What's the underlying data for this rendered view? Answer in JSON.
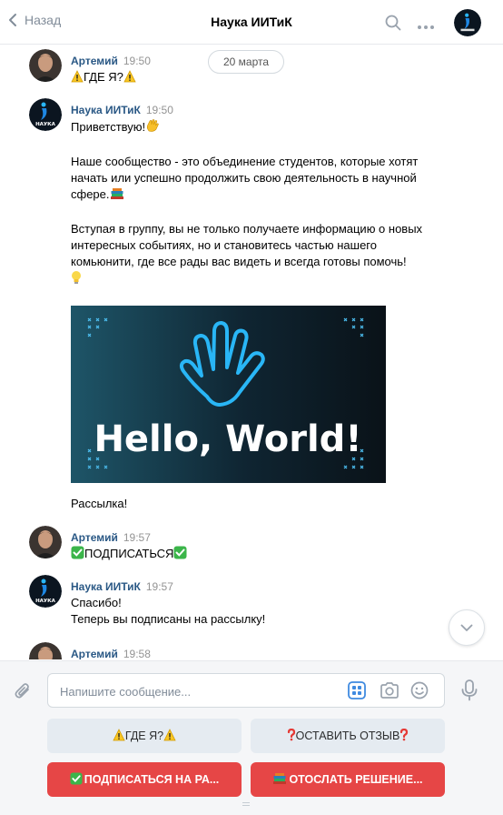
{
  "header": {
    "back_label": "Назад",
    "title": "Наука ИИТиК"
  },
  "date_separator": "20 марта",
  "messages": [
    {
      "author": "Артемий",
      "time": "19:50",
      "avatar": "user-photo",
      "lines": [
        "ГДЕ Я?"
      ]
    },
    {
      "author": "Наука ИИТиК",
      "time": "19:50",
      "avatar": "community-logo",
      "p1": "Приветствую!",
      "p2": "Наше сообщество - это объединение студентов, которые хотят начать или успешно продолжить свою деятельность в научной сфере.",
      "p3": "Вступая в группу, вы не только получаете информацию о новых интересных событиях, но и становитесь частью нашего комьюнити, где все рады вас видеть и всегда готовы помочь!",
      "image_text": "Hello, World!",
      "p4": "Рассылка!"
    },
    {
      "author": "Артемий",
      "time": "19:57",
      "avatar": "user-photo",
      "lines": [
        "ПОДПИСАТЬСЯ"
      ]
    },
    {
      "author": "Наука ИИТиК",
      "time": "19:57",
      "avatar": "community-logo",
      "lines": [
        "Спасибо!",
        "Теперь вы подписаны на рассылку!"
      ]
    },
    {
      "author": "Артемий",
      "time": "19:58",
      "avatar": "user-photo"
    }
  ],
  "logo_text": "НАУКА",
  "composer": {
    "placeholder": "Напишите сообщение..."
  },
  "keyboard": [
    {
      "label": "ГДЕ Я?",
      "style": "gray"
    },
    {
      "label": "ОСТАВИТЬ ОТЗЫВ",
      "style": "gray"
    },
    {
      "label": "ПОДПИСАТЬСЯ НА РА...",
      "style": "red"
    },
    {
      "label": "ОТОСЛАТЬ РЕШЕНИЕ...",
      "style": "red"
    }
  ],
  "colors": {
    "link": "#2a5885",
    "accent_red": "#e64646",
    "button_gray": "#e5ebf1",
    "icon": "#818c99",
    "brand_blue": "#1e88e5"
  },
  "icons": [
    "chevron-left-icon",
    "search-icon",
    "more-icon",
    "keyboard-icon",
    "camera-icon",
    "smile-icon",
    "microphone-icon",
    "paperclip-icon",
    "chevron-down-icon",
    "warning-emoji",
    "wave-emoji",
    "books-emoji",
    "lightbulb-emoji",
    "check-emoji",
    "question-emoji"
  ]
}
